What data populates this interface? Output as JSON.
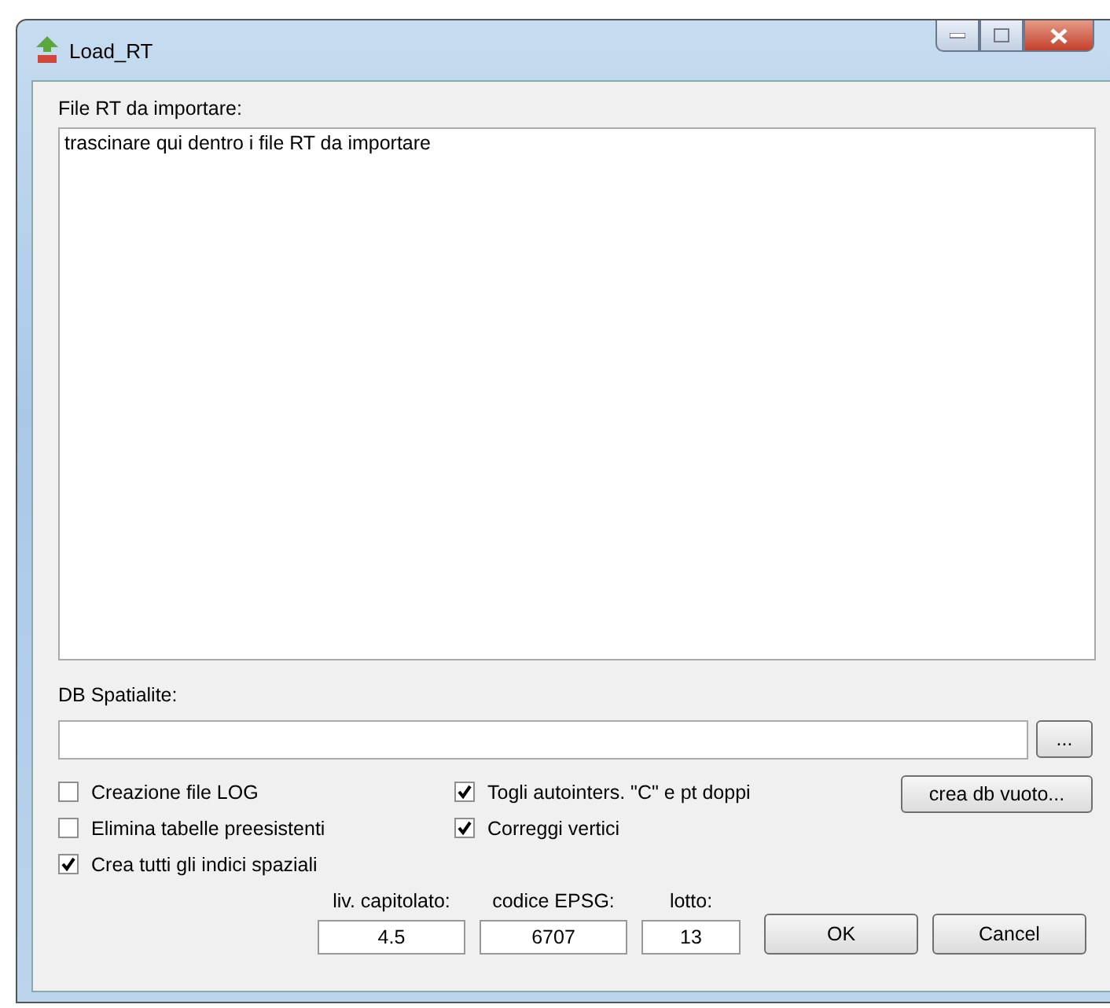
{
  "window": {
    "title": "Load_RT"
  },
  "files": {
    "label": "File RT da importare:",
    "hint": "trascinare qui dentro i file RT da importare"
  },
  "db": {
    "label": "DB Spatialite:",
    "browse_button": "..."
  },
  "options_left": [
    {
      "label": "Creazione file LOG",
      "checked": false
    },
    {
      "label": "Elimina tabelle preesistenti",
      "checked": false
    },
    {
      "label": "Crea tutti gli indici spaziali",
      "checked": true
    }
  ],
  "options_right": [
    {
      "label": "Togli autointers. \"C\" e pt doppi",
      "checked": true
    },
    {
      "label": "Correggi vertici",
      "checked": true
    }
  ],
  "create_db_button": "crea db vuoto...",
  "fields": [
    {
      "label": "liv. capitolato:",
      "value": "4.5"
    },
    {
      "label": "codice EPSG:",
      "value": "6707"
    },
    {
      "label": "lotto:",
      "value": "13"
    }
  ],
  "buttons": [
    "OK",
    "Cancel"
  ]
}
